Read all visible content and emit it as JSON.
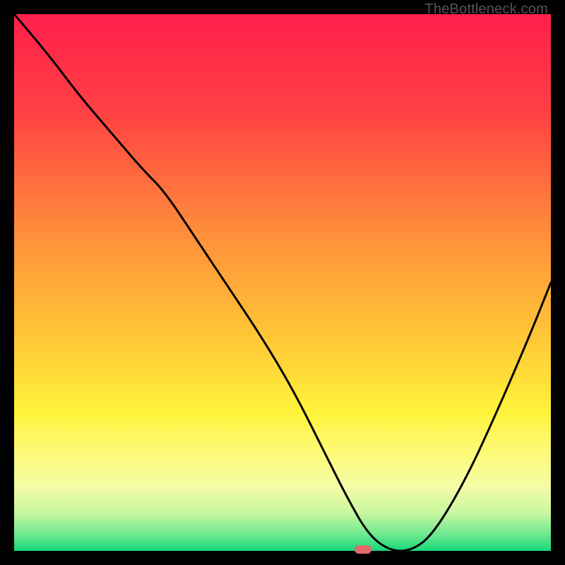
{
  "watermark": "TheBottleneck.com",
  "marker": {
    "color": "#e26a6a",
    "x_percent": 65,
    "y_percent": 100
  },
  "gradient_stops": [
    {
      "pos": 0,
      "color": "#ff1f4b"
    },
    {
      "pos": 18,
      "color": "#ff4044"
    },
    {
      "pos": 40,
      "color": "#ff8b3a"
    },
    {
      "pos": 60,
      "color": "#ffc636"
    },
    {
      "pos": 74,
      "color": "#fff23a"
    },
    {
      "pos": 82,
      "color": "#fdfb7a"
    },
    {
      "pos": 88,
      "color": "#f4fca6"
    },
    {
      "pos": 93,
      "color": "#c8f7a0"
    },
    {
      "pos": 97,
      "color": "#6be88f"
    },
    {
      "pos": 100,
      "color": "#17d67a"
    }
  ],
  "chart_data": {
    "type": "line",
    "title": "",
    "xlabel": "",
    "ylabel": "",
    "xlim": [
      0,
      100
    ],
    "ylim": [
      0,
      100
    ],
    "note": "Values are % of plot width/height; curve y read visually (100=top, 0=bottom).",
    "series": [
      {
        "name": "curve",
        "x": [
          0,
          6,
          12,
          18,
          24,
          28,
          34,
          40,
          46,
          52,
          58,
          62,
          66,
          70,
          74,
          78,
          84,
          90,
          96,
          100
        ],
        "y": [
          100,
          93,
          85,
          78,
          71,
          67,
          58,
          49,
          40,
          30,
          18,
          10,
          3,
          0,
          0,
          3,
          13,
          26,
          40,
          50
        ]
      }
    ],
    "marker_point": {
      "x": 65,
      "y": 0
    }
  }
}
